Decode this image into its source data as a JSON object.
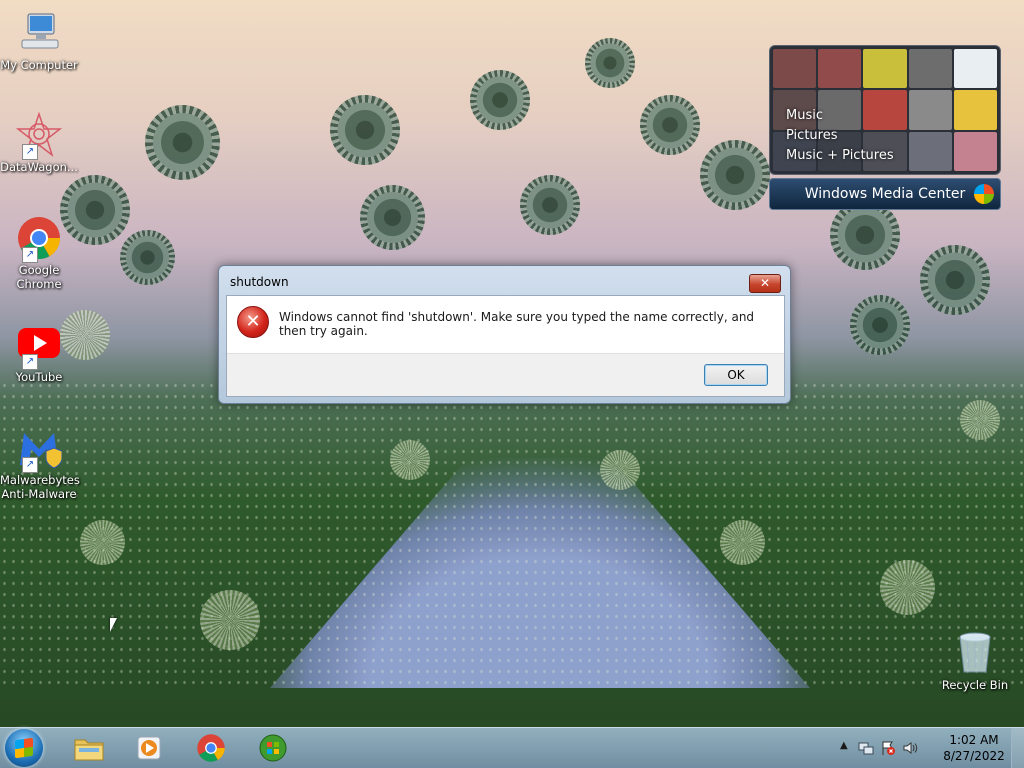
{
  "desktop": {
    "icons": [
      {
        "label": "My Computer"
      },
      {
        "label": "DataWagon..."
      },
      {
        "label": "Google Chrome"
      },
      {
        "label": "YouTube"
      },
      {
        "label": "Malwarebytes Anti-Malware"
      },
      {
        "label": "Recycle Bin"
      }
    ]
  },
  "media_center": {
    "menu": [
      "Music",
      "Pictures",
      "Music + Pictures"
    ],
    "brand": "Windows Media Center"
  },
  "dialog": {
    "title": "shutdown",
    "close_label": "✕",
    "message": "Windows cannot find 'shutdown'. Make sure you typed the name correctly, and then try again.",
    "ok_label": "OK"
  },
  "taskbar": {
    "pinned": [
      "windows-explorer",
      "windows-media-player",
      "google-chrome",
      "windows-media-center"
    ],
    "clock_time": "1:02 AM",
    "clock_date": "8/27/2022"
  }
}
